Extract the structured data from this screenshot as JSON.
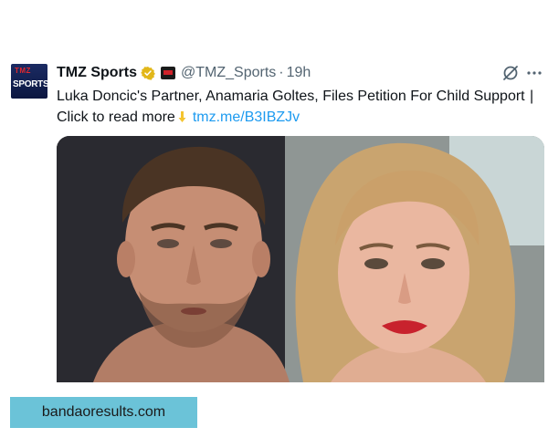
{
  "tweet": {
    "avatar": {
      "line1": "TMZ",
      "line2": "SPORTS"
    },
    "display_name": "TMZ Sports",
    "handle": "@TMZ_Sports",
    "separator": "·",
    "time": "19h",
    "text_main": "Luka Doncic's Partner, Anamaria Goltes, Files Petition For Child Support",
    "text_bar": "|",
    "text_cta": "Click to read more",
    "link": "tmz.me/B3IBZJv",
    "icons": [
      "verified-icon",
      "affiliate-badge-icon",
      "grok-icon",
      "more-icon",
      "pointing-down-icon"
    ],
    "colors": {
      "link": "#1d9bf0",
      "verified": "#e2b719",
      "secondary": "#536471"
    }
  },
  "watermark": {
    "text": "bandaoresults.com",
    "color": "#6bc3d8"
  }
}
